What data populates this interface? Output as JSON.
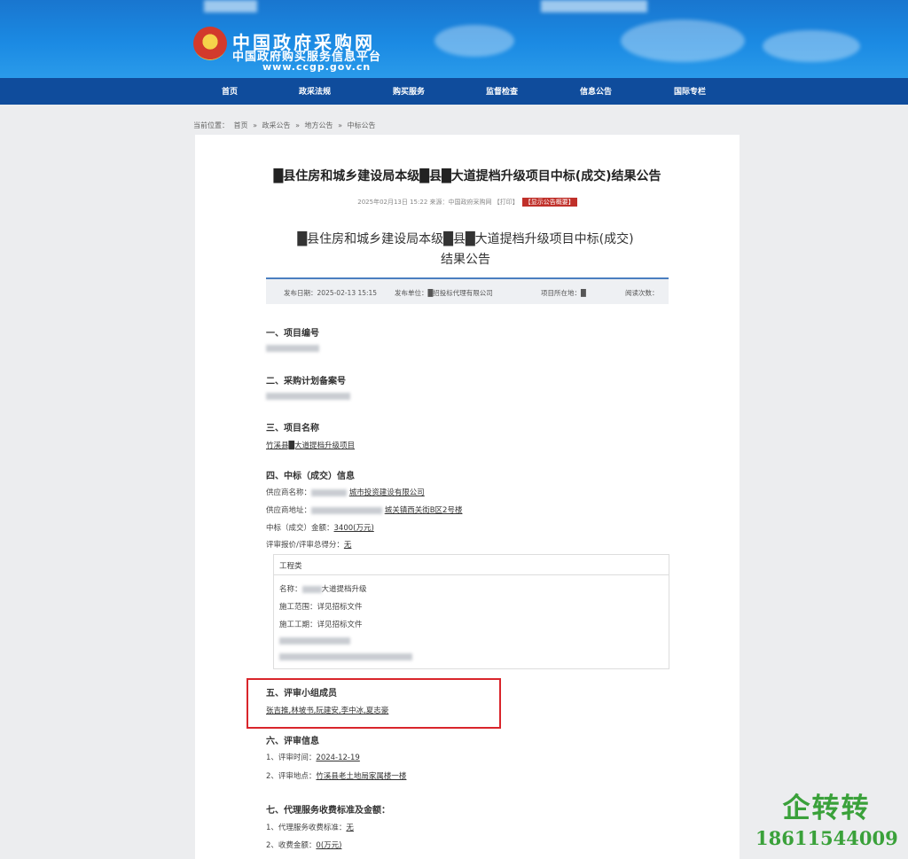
{
  "header": {
    "logo_cn": "中国政府采购网",
    "logo_sub": "中国政府购买服务信息平台",
    "logo_url": "www.ccgp.gov.cn"
  },
  "nav": {
    "items": [
      "首页",
      "政采法规",
      "购买服务",
      "监督检查",
      "信息公告",
      "国际专栏"
    ]
  },
  "breadcrumb": [
    "当前位置：",
    "首页",
    "»",
    "政采公告",
    "»",
    "地方公告",
    "»",
    "中标公告"
  ],
  "outer": {
    "title": "█县住房和城乡建设局本级█县█大道提档升级项目中标(成交)结果公告",
    "meta": "2025年02月13日 15:22 来源：中国政府采购网 【打印】",
    "meta_tag": "【显示公告概要】"
  },
  "inner": {
    "title_line1": "█县住房和城乡建设局本级█县█大道提档升级项目中标(成交)",
    "title_line2": "结果公告",
    "info": {
      "date": "发布日期：2025-02-13 15:15",
      "publisher": "发布单位：█招投标代理有限公司",
      "region": "项目所在地：█",
      "views": "阅读次数："
    }
  },
  "sections": {
    "s1_title": "一、项目编号",
    "s2_title": "二、采购计划备案号",
    "s3_title": "三、项目名称",
    "s3_value": "竹溪县█大道提档升级项目",
    "s4_title": "四、中标（成交）信息",
    "supplier_name_label": "供应商名称：",
    "supplier_name_value": "城市投资建设有限公司",
    "supplier_addr_label": "供应商地址：",
    "supplier_addr_value": "城关镇西关街B区2号楼",
    "amount_label": "中标（成交）金额：",
    "amount_value": "3400(万元)",
    "score_label": "评审报价/评审总得分：",
    "score_value": "无",
    "box_header": "工程类",
    "box_name_label": "名称：",
    "box_name_value": "大道提档升级",
    "box_scope": "施工范围：详见招标文件",
    "box_period": "施工工期：详见招标文件",
    "s5_title": "五、评审小组成员",
    "s5_value": "张吉推,林坡书,阮建安,李中冰,夏志豪",
    "s6_title": "六、评审信息",
    "s6_time_label": "1、评审时间：",
    "s6_time_value": "2024-12-19",
    "s6_place_label": "2、评审地点：",
    "s6_place_value": "竹溪县老土地局家属楼一楼",
    "s7_title": "七、代理服务收费标准及金额：",
    "s7_std_label": "1、代理服务收费标准：",
    "s7_std_value": "无",
    "s7_amt_label": "2、收费金额：",
    "s7_amt_value": "0(万元)"
  },
  "watermark": {
    "title": "企转转",
    "phone": "18611544009"
  },
  "colors": {
    "header_blue": "#1b8ae3",
    "nav_blue": "#0f4c9c",
    "highlight_red": "#d9252b",
    "watermark_green": "#3aa13a"
  }
}
